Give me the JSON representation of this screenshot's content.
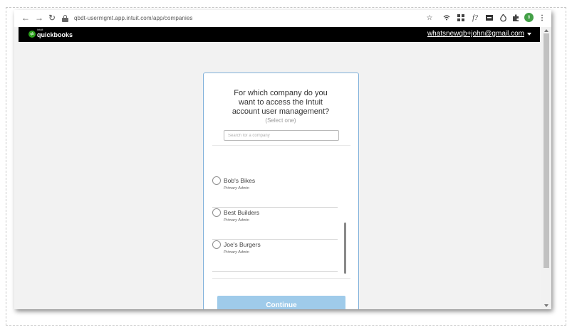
{
  "browser": {
    "url": "qbdt-usermgmt.app.intuit.com/app/companies",
    "nav_icons": [
      "back-arrow-icon",
      "forward-arrow-icon",
      "reload-icon"
    ],
    "extension_icons": [
      "star-icon",
      "wifi-icon",
      "grid-icon",
      "function-icon",
      "box-icon",
      "flame-icon",
      "puzzle-icon",
      "extension-badge-icon",
      "kebab-menu-icon"
    ],
    "extension_badge_text": "8"
  },
  "header": {
    "logo_small": "intuit",
    "brand": "quickbooks",
    "user_email": "whatsnewqb+john@gmail.com"
  },
  "card": {
    "title_line1": "For which company do you",
    "title_line2": "want to access the Intuit",
    "title_line3": "account user management?",
    "subtitle": "(Select one)",
    "search_placeholder": "Search for a company",
    "companies": [
      {
        "name": "Bob's Bikes",
        "role": "Primary Admin"
      },
      {
        "name": "Best Builders",
        "role": "Primary Admin"
      },
      {
        "name": "Joe's Burgers",
        "role": "Primary Admin"
      }
    ],
    "continue_label": "Continue"
  },
  "colors": {
    "card_border": "#7fb0da",
    "continue_button": "#9fcbea",
    "header_bg": "#000000",
    "brand_green": "#2ca01c"
  }
}
